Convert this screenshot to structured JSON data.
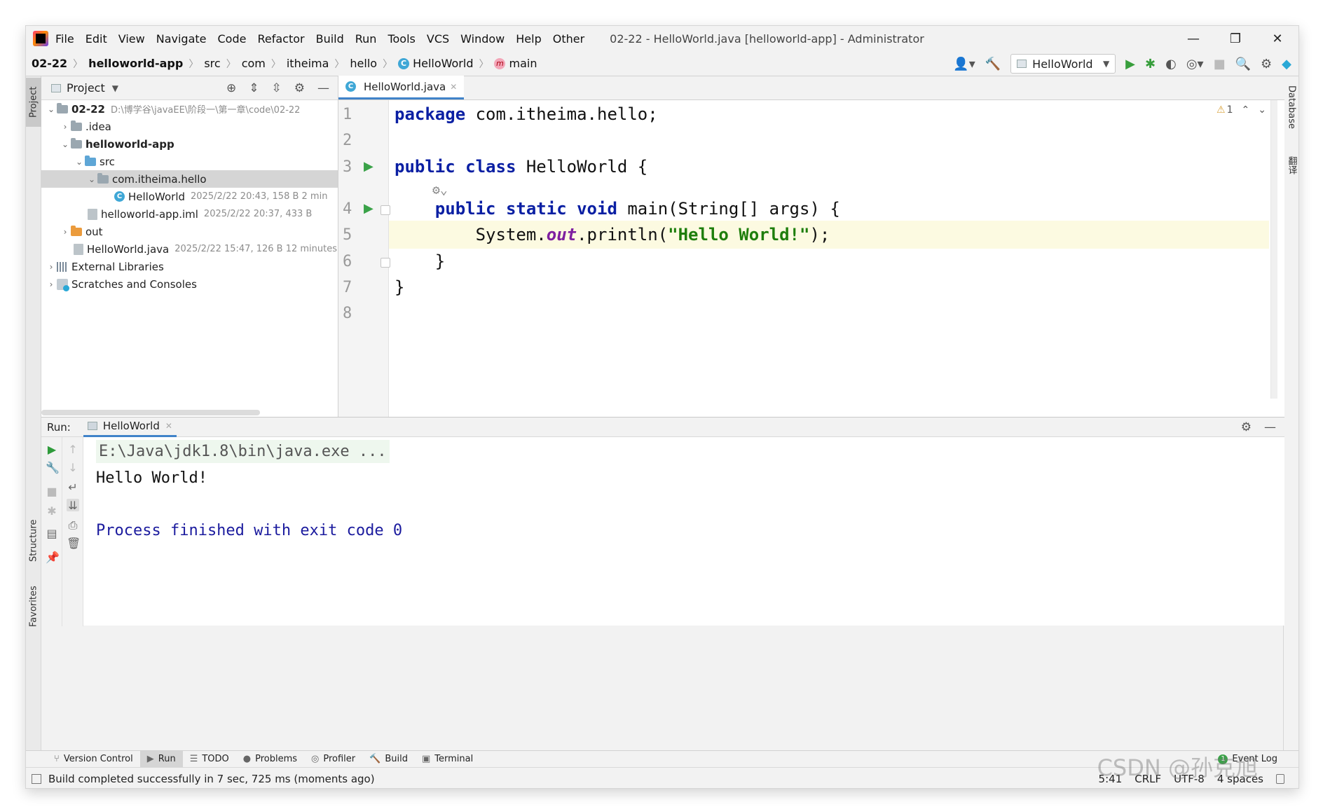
{
  "menu": {
    "items": [
      "File",
      "Edit",
      "View",
      "Navigate",
      "Code",
      "Refactor",
      "Build",
      "Run",
      "Tools",
      "VCS",
      "Window",
      "Help",
      "Other"
    ],
    "window_title": "02-22 - HelloWorld.java [helloworld-app] - Administrator",
    "minimize": "—",
    "restore": "❐",
    "close": "✕"
  },
  "breadcrumb": [
    "02-22",
    "helloworld-app",
    "src",
    "com",
    "itheima",
    "hello",
    "HelloWorld",
    "main"
  ],
  "toolbar": {
    "run_config": "HelloWorld"
  },
  "left_tools": {
    "project": "Project",
    "structure": "Structure",
    "favorites": "Favorites"
  },
  "right_tools": {
    "database": "Database",
    "translate": "翻译"
  },
  "project_panel": {
    "title": "Project",
    "tree": [
      {
        "name": "02-22",
        "meta": "D:\\博学谷\\javaEE\\阶段一\\第一章\\code\\02-22"
      },
      {
        "name": ".idea",
        "meta": ""
      },
      {
        "name": "helloworld-app",
        "meta": ""
      },
      {
        "name": "src",
        "meta": ""
      },
      {
        "name": "com.itheima.hello",
        "meta": ""
      },
      {
        "name": "HelloWorld",
        "meta": "2025/2/22 20:43, 158 B 2 min"
      },
      {
        "name": "helloworld-app.iml",
        "meta": "2025/2/22 20:37, 433 B"
      },
      {
        "name": "out",
        "meta": ""
      },
      {
        "name": "HelloWorld.java",
        "meta": "2025/2/22 15:47, 126 B 12 minutes"
      },
      {
        "name": "External Libraries",
        "meta": ""
      },
      {
        "name": "Scratches and Consoles",
        "meta": ""
      }
    ]
  },
  "editor": {
    "tab": "HelloWorld.java",
    "line_numbers": [
      "1",
      "2",
      "3",
      "4",
      "5",
      "6",
      "7",
      "8"
    ],
    "warnings": "1",
    "code": {
      "l1_kw": "package",
      "l1_rest": " com.itheima.hello;",
      "l3_kw1": "public",
      "l3_kw2": "class",
      "l3_rest": " HelloWorld {",
      "l4_indent": "    ",
      "l4_kw1": "public",
      "l4_kw2": "static",
      "l4_kw3": "void",
      "l4_rest": " main(String[] args) {",
      "l5_pre": "        System.",
      "l5_field": "out",
      "l5_mid": ".println(",
      "l5_str": "\"Hello World!\"",
      "l5_end": ");",
      "l6": "    }",
      "l7": "}"
    }
  },
  "run_panel": {
    "label": "Run:",
    "tab": "HelloWorld",
    "console": {
      "cmd": "E:\\Java\\jdk1.8\\bin\\java.exe ...",
      "output": "Hello World!",
      "process": "Process finished with exit code 0"
    }
  },
  "tool_windows": {
    "version_control": "Version Control",
    "run": "Run",
    "todo": "TODO",
    "problems": "Problems",
    "profiler": "Profiler",
    "build": "Build",
    "terminal": "Terminal",
    "event_log": "Event Log",
    "event_count": "1"
  },
  "status_bar": {
    "message": "Build completed successfully in 7 sec, 725 ms (moments ago)",
    "position": "5:41",
    "line_sep": "CRLF",
    "encoding": "UTF-8",
    "indent": "4 spaces"
  },
  "watermark": "CSDN @孙克旭",
  "colors": {
    "keyword": "#0a1fa3",
    "string": "#1e7e0c",
    "field": "#7e1fa0",
    "run_green": "#389e3c",
    "tab_underline": "#4083c9"
  }
}
